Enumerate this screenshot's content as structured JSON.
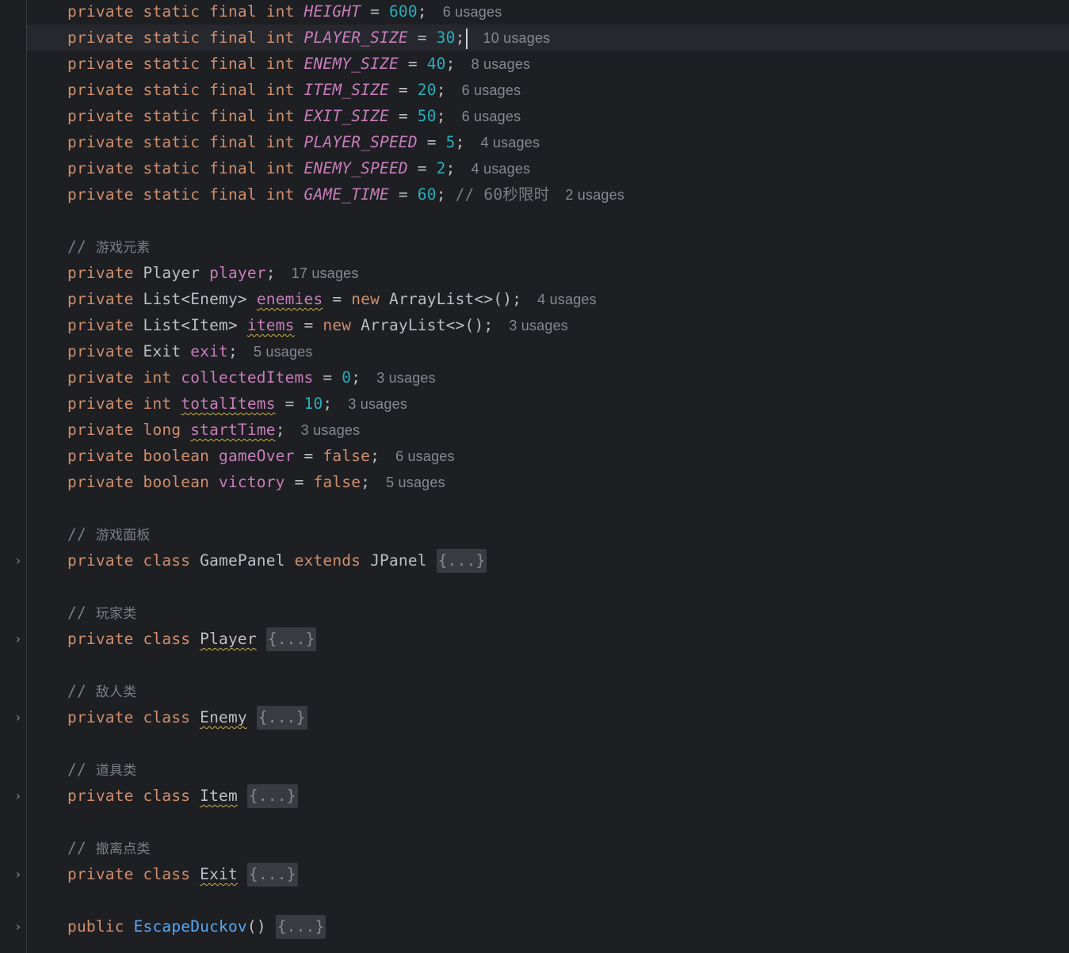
{
  "editor": {
    "lines": [
      {
        "kw": "private static final int ",
        "name": "HEIGHT",
        "eq": " = ",
        "val": "600",
        "end": ";",
        "hint": "6 usages"
      },
      {
        "kw": "private static final int ",
        "name": "PLAYER_SIZE",
        "eq": " = ",
        "val": "30",
        "end": ";",
        "hint": "10 usages"
      },
      {
        "kw": "private static final int ",
        "name": "ENEMY_SIZE",
        "eq": " = ",
        "val": "40",
        "end": ";",
        "hint": "8 usages"
      },
      {
        "kw": "private static final int ",
        "name": "ITEM_SIZE",
        "eq": " = ",
        "val": "20",
        "end": ";",
        "hint": "6 usages"
      },
      {
        "kw": "private static final int ",
        "name": "EXIT_SIZE",
        "eq": " = ",
        "val": "50",
        "end": ";",
        "hint": "6 usages"
      },
      {
        "kw": "private static final int ",
        "name": "PLAYER_SPEED",
        "eq": " = ",
        "val": "5",
        "end": ";",
        "hint": "4 usages"
      },
      {
        "kw": "private static final int ",
        "name": "ENEMY_SPEED",
        "eq": " = ",
        "val": "2",
        "end": ";",
        "hint": "4 usages"
      },
      {
        "kw": "private static final int ",
        "name": "GAME_TIME",
        "eq": " = ",
        "val": "60",
        "end": ";",
        "comment_prefix": " // ",
        "comment": "60秒限时",
        "hint": "2 usages"
      }
    ],
    "comment_elements": {
      "slashes": "// ",
      "text": "游戏元素"
    },
    "fields": [
      {
        "kw": "private ",
        "type": "Player ",
        "name": "player",
        "end": ";",
        "hint": "17 usages"
      },
      {
        "kw": "private ",
        "type": "List<Enemy> ",
        "name": "enemies",
        "eq": " = ",
        "kw2": "new ",
        "rest": "ArrayList<>();",
        "hint": "4 usages"
      },
      {
        "kw": "private ",
        "type": "List<Item> ",
        "name": "items",
        "eq": " = ",
        "kw2": "new ",
        "rest": "ArrayList<>();",
        "hint": "3 usages"
      },
      {
        "kw": "private ",
        "type": "Exit ",
        "name": "exit",
        "end": ";",
        "hint": "5 usages"
      },
      {
        "kw": "private int ",
        "name": "collectedItems",
        "eq": " = ",
        "val": "0",
        "end": ";",
        "hint": "3 usages"
      },
      {
        "kw": "private int ",
        "name": "totalItems",
        "eq": " = ",
        "val": "10",
        "end": ";",
        "hint": "3 usages"
      },
      {
        "kw": "private long ",
        "name": "startTime",
        "end": ";",
        "hint": "3 usages"
      },
      {
        "kw": "private boolean ",
        "name": "gameOver",
        "eq": " = ",
        "kw2": "false",
        "end": ";",
        "hint": "6 usages"
      },
      {
        "kw": "private boolean ",
        "name": "victory",
        "eq": " = ",
        "kw2": "false",
        "end": ";",
        "hint": "5 usages"
      }
    ],
    "classes": [
      {
        "comment": "游戏面板",
        "kw": "private class ",
        "name": "GamePanel",
        "ext_kw": " extends ",
        "ext": "JPanel",
        "fold": "{...}"
      },
      {
        "comment": "玩家类",
        "kw": "private class ",
        "name": "Player",
        "fold": "{...}"
      },
      {
        "comment": "敌人类",
        "kw": "private class ",
        "name": "Enemy",
        "fold": "{...}"
      },
      {
        "comment": "道具类",
        "kw": "private class ",
        "name": "Item",
        "fold": "{...}"
      },
      {
        "comment": "撤离点类",
        "kw": "private class ",
        "name": "Exit",
        "fold": "{...}"
      }
    ],
    "constructor": {
      "kw": "public ",
      "name": "EscapeDuckov",
      "parens": "()",
      "fold": "{...}"
    },
    "colors": {
      "background": "#1e1f22",
      "keyword": "#cf8e6d",
      "constant": "#c77dbb",
      "number": "#2aacb8",
      "function": "#56a8f5",
      "comment": "#7a7e85",
      "hint": "#868991"
    },
    "icons": {
      "fold_chevron": "chevron-right-icon"
    }
  }
}
